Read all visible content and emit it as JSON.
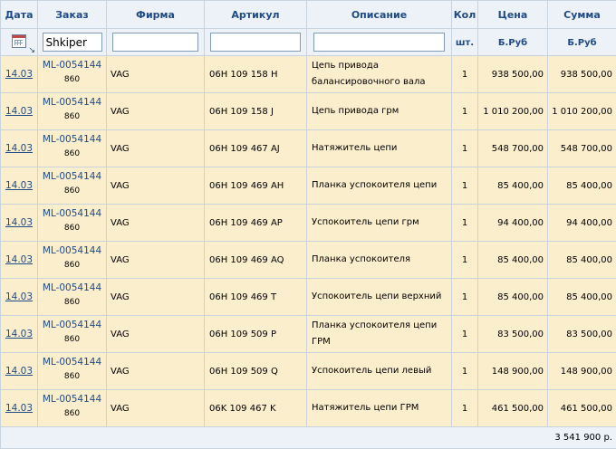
{
  "columns": {
    "date": "Дата",
    "order": "Заказ",
    "firm": "Фирма",
    "article": "Артикул",
    "description": "Описание",
    "qty": "Кол",
    "price": "Цена",
    "sum": "Сумма"
  },
  "filters": {
    "order_value": "Shkiper",
    "firm_value": "",
    "article_value": "",
    "description_value": "",
    "qty_unit": "шт.",
    "price_unit": "Б.Руб",
    "sum_unit": "Б.Руб"
  },
  "rows": [
    {
      "date": "14.03",
      "order": "ML-0054144",
      "order_sub": "860",
      "firm": "VAG",
      "article": "06H 109 158 H",
      "description": "Цепь привода балансировочного вала",
      "qty": "1",
      "price": "938 500,00",
      "sum": "938 500,00"
    },
    {
      "date": "14.03",
      "order": "ML-0054144",
      "order_sub": "860",
      "firm": "VAG",
      "article": "06H 109 158 J",
      "description": "Цепь привода грм",
      "qty": "1",
      "price": "1 010 200,00",
      "sum": "1 010 200,00"
    },
    {
      "date": "14.03",
      "order": "ML-0054144",
      "order_sub": "860",
      "firm": "VAG",
      "article": "06H 109 467 AJ",
      "description": "Натяжитель цепи",
      "qty": "1",
      "price": "548 700,00",
      "sum": "548 700,00"
    },
    {
      "date": "14.03",
      "order": "ML-0054144",
      "order_sub": "860",
      "firm": "VAG",
      "article": "06H 109 469 AH",
      "description": "Планка успокоителя цепи",
      "qty": "1",
      "price": "85 400,00",
      "sum": "85 400,00"
    },
    {
      "date": "14.03",
      "order": "ML-0054144",
      "order_sub": "860",
      "firm": "VAG",
      "article": "06H 109 469 AP",
      "description": "Успокоитель цепи грм",
      "qty": "1",
      "price": "94 400,00",
      "sum": "94 400,00"
    },
    {
      "date": "14.03",
      "order": "ML-0054144",
      "order_sub": "860",
      "firm": "VAG",
      "article": "06H 109 469 AQ",
      "description": "Планка успокоителя",
      "qty": "1",
      "price": "85 400,00",
      "sum": "85 400,00"
    },
    {
      "date": "14.03",
      "order": "ML-0054144",
      "order_sub": "860",
      "firm": "VAG",
      "article": "06H 109 469 T",
      "description": "Успокоитель цепи верхний",
      "qty": "1",
      "price": "85 400,00",
      "sum": "85 400,00"
    },
    {
      "date": "14.03",
      "order": "ML-0054144",
      "order_sub": "860",
      "firm": "VAG",
      "article": "06H 109 509 P",
      "description": "Планка успокоителя цепи ГРМ",
      "qty": "1",
      "price": "83 500,00",
      "sum": "83 500,00"
    },
    {
      "date": "14.03",
      "order": "ML-0054144",
      "order_sub": "860",
      "firm": "VAG",
      "article": "06H 109 509 Q",
      "description": "Успокоитель цепи левый",
      "qty": "1",
      "price": "148 900,00",
      "sum": "148 900,00"
    },
    {
      "date": "14.03",
      "order": "ML-0054144",
      "order_sub": "860",
      "firm": "VAG",
      "article": "06K 109 467 K",
      "description": "Натяжитель цепи ГРМ",
      "qty": "1",
      "price": "461 500,00",
      "sum": "461 500,00"
    }
  ],
  "total": "3 541 900 р.",
  "icons": {
    "calendar": "calendar-icon",
    "sort": "sort-arrow-icon"
  },
  "colors": {
    "header_bg": "#ecf2f8",
    "header_text": "#1f4a86",
    "row_bg": "#fbeecd",
    "border": "#c9d3de"
  }
}
